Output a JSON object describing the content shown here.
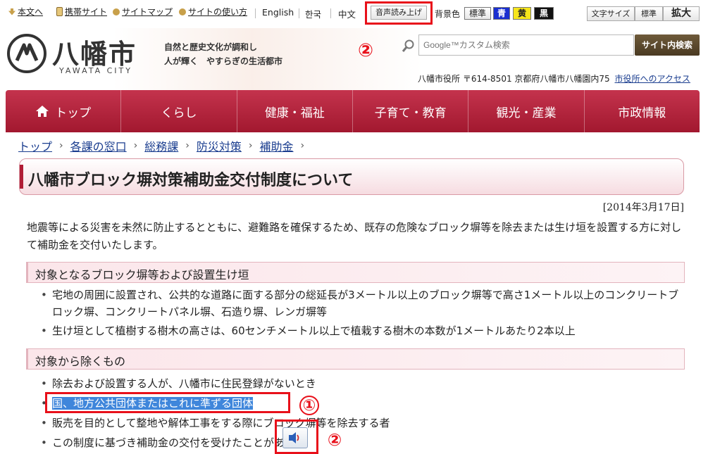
{
  "utility_links": [
    {
      "label": "本文へ"
    },
    {
      "label": "携帯サイト"
    },
    {
      "label": "サイトマップ"
    },
    {
      "label": "サイトの使い方"
    }
  ],
  "languages": [
    "English",
    "한국",
    "中文"
  ],
  "voice_button": "音声読み上げ",
  "bg_color": {
    "label": "背景色",
    "options": [
      "標準",
      "青",
      "黄",
      "黒"
    ]
  },
  "font_size": {
    "label": "文字サイズ",
    "options": [
      "標準",
      "拡大"
    ]
  },
  "logo": {
    "name": "八幡市",
    "sub": "YAWATA CITY"
  },
  "tagline": [
    "自然と歴史文化が調和し",
    "人が輝く　やすらぎの生活都市"
  ],
  "search": {
    "placeholder": "Google™カスタム検索",
    "button": "サイト内検索"
  },
  "address": "八幡市役所 〒614-8501 京都府八幡市八幡園内75",
  "access_link": "市役所へのアクセス",
  "nav": [
    "トップ",
    "くらし",
    "健康・福祉",
    "子育て・教育",
    "観光・産業",
    "市政情報"
  ],
  "breadcrumbs": [
    "トップ",
    "各課の窓口",
    "総務課",
    "防災対策",
    "補助金"
  ],
  "page_title": "八幡市ブロック塀対策補助金交付制度について",
  "date": "[2014年3月17日]",
  "intro": "地震等による災害を未然に防止するとともに、避難路を確保するため、既存の危険なブロック塀等を除去または生け垣を設置する方に対して補助金を交付いたします。",
  "section1": {
    "heading": "対象となるブロック塀等および設置生け垣",
    "items": [
      "宅地の周囲に設置され、公共的な道路に面する部分の総延長が3メートル以上のブロック塀等で高さ1メートル以上のコンクリートブロック塀、コンクリートパネル塀、石造り塀、レンガ塀等",
      "生け垣として植樹する樹木の高さは、60センチメートル以上で植栽する樹木の本数が1メートルあたり2本以上"
    ]
  },
  "section2": {
    "heading": "対象から除くもの",
    "items": [
      "除去および設置する人が、八幡市に住民登録がないとき",
      "国、地方公共団体またはこれに準ずる団体",
      "販売を目的として整地や解体工事をする際にブロック塀等を除去する者",
      "この制度に基づき補助金の交付を受けたことがある者"
    ]
  },
  "markers": {
    "one": "①",
    "two": "②"
  },
  "colors": {
    "nav": "#b0213b",
    "highlight": "#3f86db",
    "marker": "#e8101a",
    "heading_bg": "#fbe6ea"
  }
}
